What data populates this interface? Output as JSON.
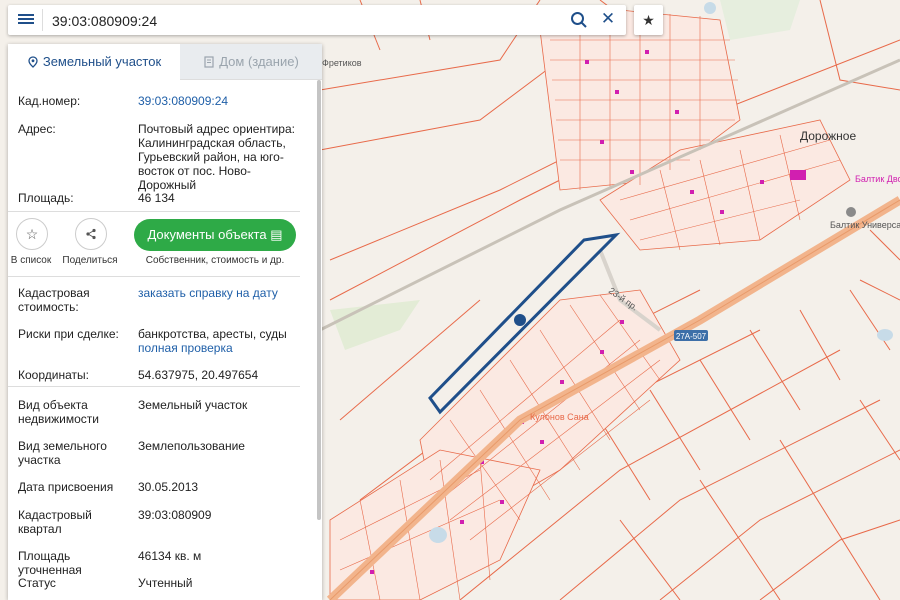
{
  "search": {
    "value": "39:03:080909:24"
  },
  "tabs": [
    {
      "label": "Земельный участок"
    },
    {
      "label": "Дом (здание)"
    }
  ],
  "info": {
    "cad_number": {
      "label": "Кад.номер:",
      "value": "39:03:080909:24"
    },
    "address": {
      "label": "Адрес:",
      "value": "Почтовый адрес ориентира: Калининградская область, Гурьевский район, на юго-восток от пос. Ново-Дорожный"
    },
    "area": {
      "label": "Площадь:",
      "value": "46 134"
    }
  },
  "actions": {
    "to_list": "В список",
    "share": "Поделиться",
    "documents": "Документы объекта",
    "documents_sub": "Собственник, стоимость и др."
  },
  "details": {
    "cadastral_value": {
      "label": "Кадастровая стоимость:",
      "link": "заказать справку на дату"
    },
    "risks": {
      "label": "Риски при сделке:",
      "value": "банкротства, аресты, суды",
      "link": "полная проверка"
    },
    "coords": {
      "label": "Координаты:",
      "value": "54.637975, 20.497654"
    },
    "object_type": {
      "label": "Вид объекта недвижимости",
      "value": "Земельный участок"
    },
    "land_type": {
      "label": "Вид земельного участка",
      "value": "Землепользование"
    },
    "date": {
      "label": "Дата присвоения",
      "value": "30.05.2013"
    },
    "quarter": {
      "label": "Кадастровый квартал",
      "value": "39:03:080909"
    },
    "area_precise": {
      "label": "Площадь уточненная",
      "value": "46134 кв. м"
    },
    "status": {
      "label": "Статус",
      "value": "Учтенный"
    }
  },
  "map": {
    "labels": {
      "dorozhnoe": "Дорожное",
      "baltic": "Балтик Универсал",
      "dvor": "Балтик Двор",
      "road": "27А-507",
      "street": "23-й пр.",
      "vetikov": "Фретиков",
      "square": "Кулонов Сана"
    },
    "colors": {
      "parcel": "#e86a4a",
      "outline": "#1f4f8a",
      "road": "#f2b48c",
      "pink": "#d11fb0"
    }
  }
}
